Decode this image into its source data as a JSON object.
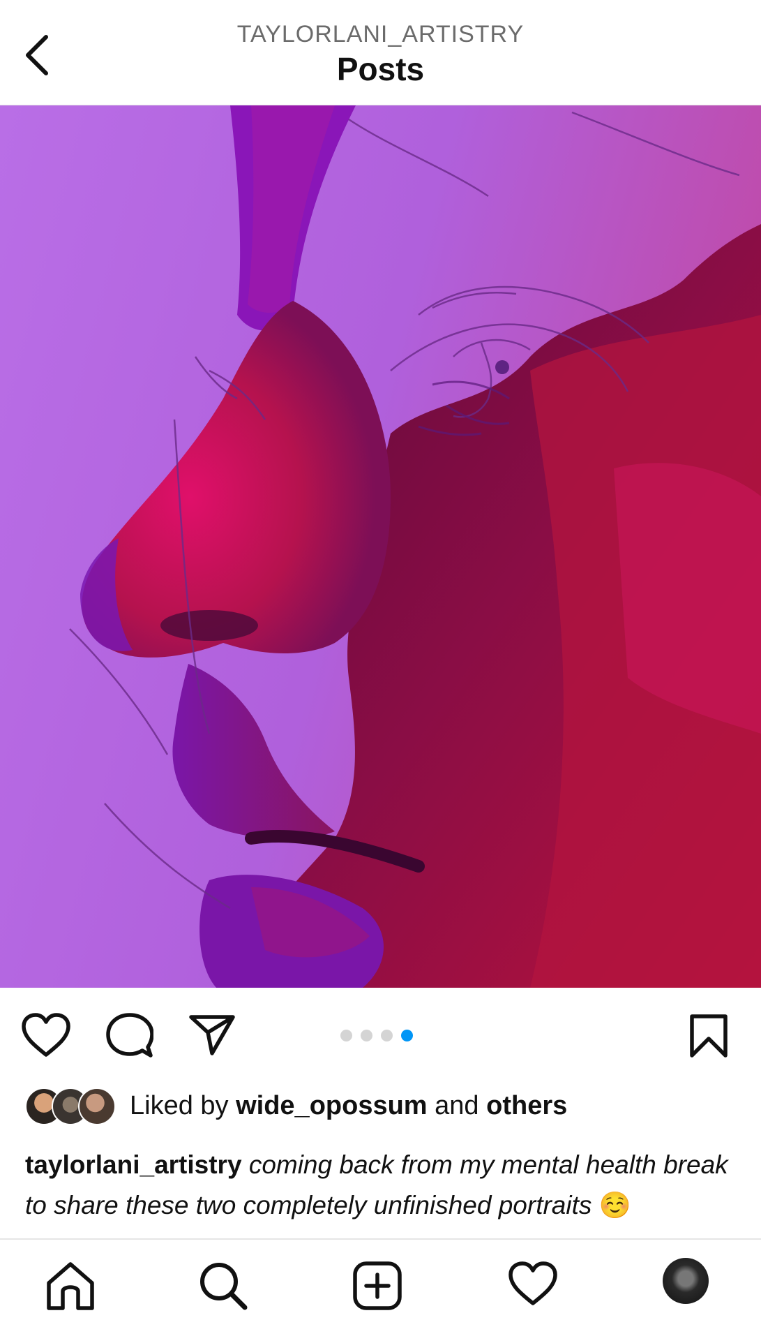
{
  "header": {
    "username": "TAYLORLANI_ARTISTRY",
    "title": "Posts"
  },
  "post": {
    "carousel_count": 4,
    "carousel_active_index": 3,
    "likes": {
      "prefix": "Liked by ",
      "user": "wide_opossum",
      "middle": " and ",
      "others": "others"
    },
    "caption": {
      "user": "taylorlani_artistry",
      "text": "coming back from my mental health break to share these two completely unfinished portraits",
      "emoji": "☺️"
    }
  },
  "icons": {
    "back": "chevron-left-icon",
    "like": "heart-icon",
    "comment": "comment-icon",
    "share": "send-icon",
    "save": "bookmark-icon",
    "nav_home": "home-icon",
    "nav_search": "search-icon",
    "nav_create": "plus-square-icon",
    "nav_activity": "heart-icon",
    "nav_profile": "avatar"
  },
  "colors": {
    "accent": "#0095f6",
    "dot_inactive": "#d4d4d4"
  }
}
